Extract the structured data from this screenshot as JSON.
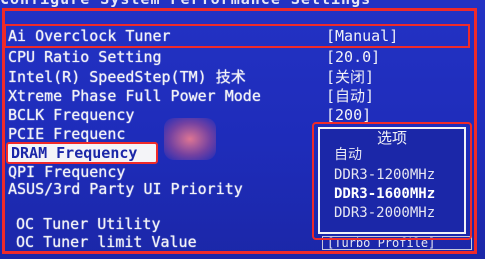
{
  "header": {
    "title": "Configure System Performance Settings"
  },
  "settings": [
    {
      "label": "Ai Overclock Tuner",
      "value": "[Manual]"
    },
    {
      "label": "CPU Ratio Setting",
      "value": "[20.0]"
    },
    {
      "label": "Intel(R) SpeedStep(TM) 技术",
      "value": "[关闭]"
    },
    {
      "label": "Xtreme Phase Full Power Mode",
      "value": "[自动]"
    },
    {
      "label": "BCLK Frequency",
      "value": "[200]"
    },
    {
      "label": "PCIE Frequenc",
      "value": ""
    },
    {
      "label": "DRAM Frequency",
      "value": ""
    },
    {
      "label": "QPI Frequency",
      "value": ""
    },
    {
      "label": "ASUS/3rd Party UI Priority",
      "value": ""
    }
  ],
  "oc": {
    "utility": "OC Tuner Utility",
    "limit": "OC Tuner limit Value",
    "limit_value": "[Turbo Profile]"
  },
  "popup": {
    "title": "选项",
    "options": [
      "自动",
      "DDR3-1200MHz",
      "DDR3-1600MHz",
      "DDR3-2000MHz"
    ],
    "selected": "DDR3-1600MHz"
  },
  "colors": {
    "background": "#1e2cba",
    "highlight_box": "#ef2a2a",
    "text": "#f2f2f7"
  }
}
